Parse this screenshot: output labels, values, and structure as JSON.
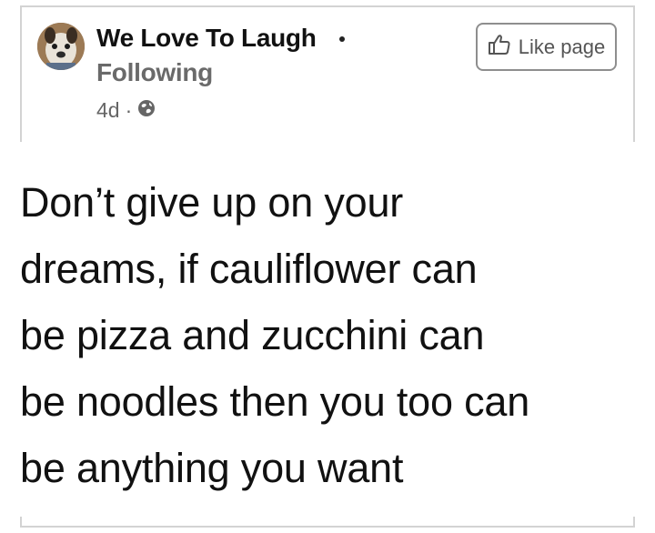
{
  "post": {
    "page_name": "We Love To Laugh",
    "separator": "·",
    "follow_status": "Following",
    "age": "4d",
    "meta_dot": "·",
    "privacy_icon": "globe-icon",
    "like_button": {
      "icon": "thumbs-up-icon",
      "label": "Like page"
    },
    "text_lines": [
      "Don’t give up on your",
      "dreams, if cauliflower can",
      "be pizza and zucchini can",
      "be noodles then you too can",
      "be anything you want"
    ]
  },
  "colors": {
    "name": "#111111",
    "following": "#6a6a6a",
    "meta": "#666666",
    "border": "#d3d3d3"
  }
}
